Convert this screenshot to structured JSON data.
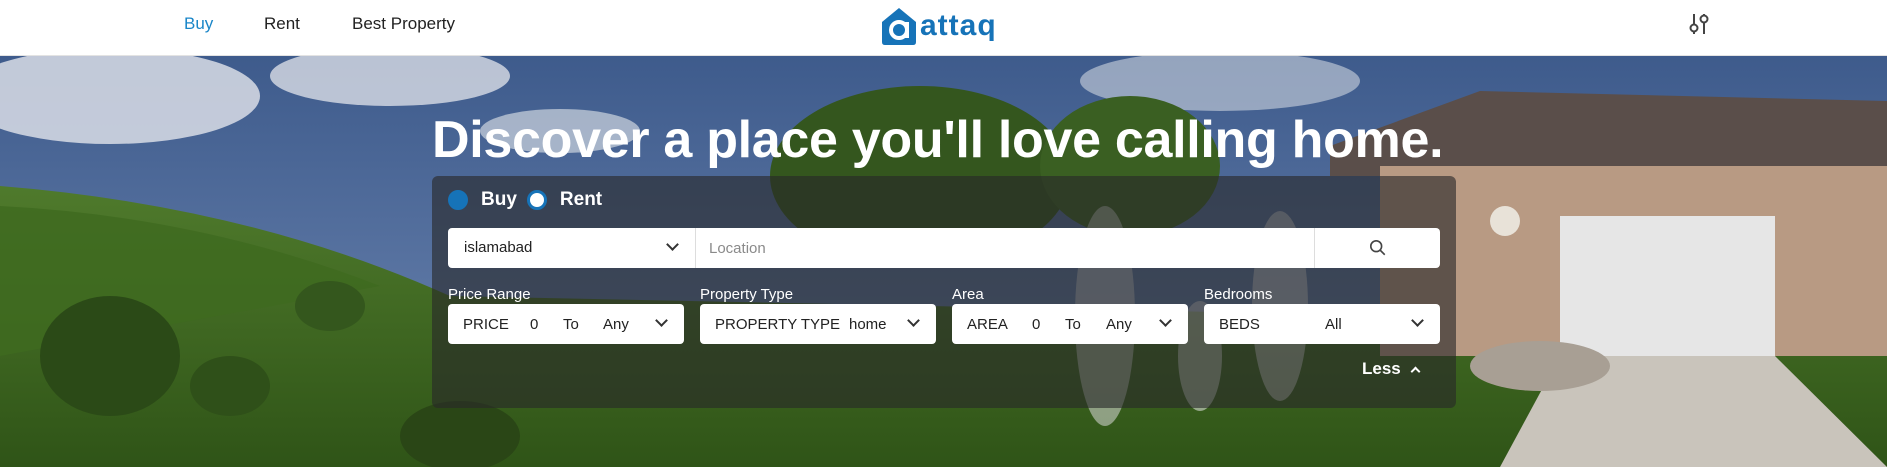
{
  "nav": {
    "links": [
      {
        "label": "Buy",
        "active": true
      },
      {
        "label": "Rent",
        "active": false
      },
      {
        "label": "Best Property",
        "active": false
      }
    ],
    "logo_text": "attaq",
    "filter_icon": "sliders-icon"
  },
  "hero": {
    "title": "Discover a place you'll love calling home."
  },
  "search": {
    "mode": {
      "options": [
        "Buy",
        "Rent"
      ],
      "selected": "Buy"
    },
    "city": "islamabad",
    "location_placeholder": "Location",
    "search_icon": "search-icon"
  },
  "filters": {
    "price": {
      "label": "Price Range",
      "prefix": "PRICE",
      "min": "0",
      "to": "To",
      "max": "Any"
    },
    "property_type": {
      "label": "Property Type",
      "prefix": "PROPERTY TYPE",
      "value": "home"
    },
    "area": {
      "label": "Area",
      "prefix": "AREA",
      "min": "0",
      "to": "To",
      "max": "Any"
    },
    "bedrooms": {
      "label": "Bedrooms",
      "prefix": "BEDS",
      "value": "All"
    }
  },
  "less_label": "Less",
  "colors": {
    "brand": "#1673b8",
    "active_nav": "#1a86c8",
    "panel_overlay": "rgba(40,40,40,0.62)"
  }
}
